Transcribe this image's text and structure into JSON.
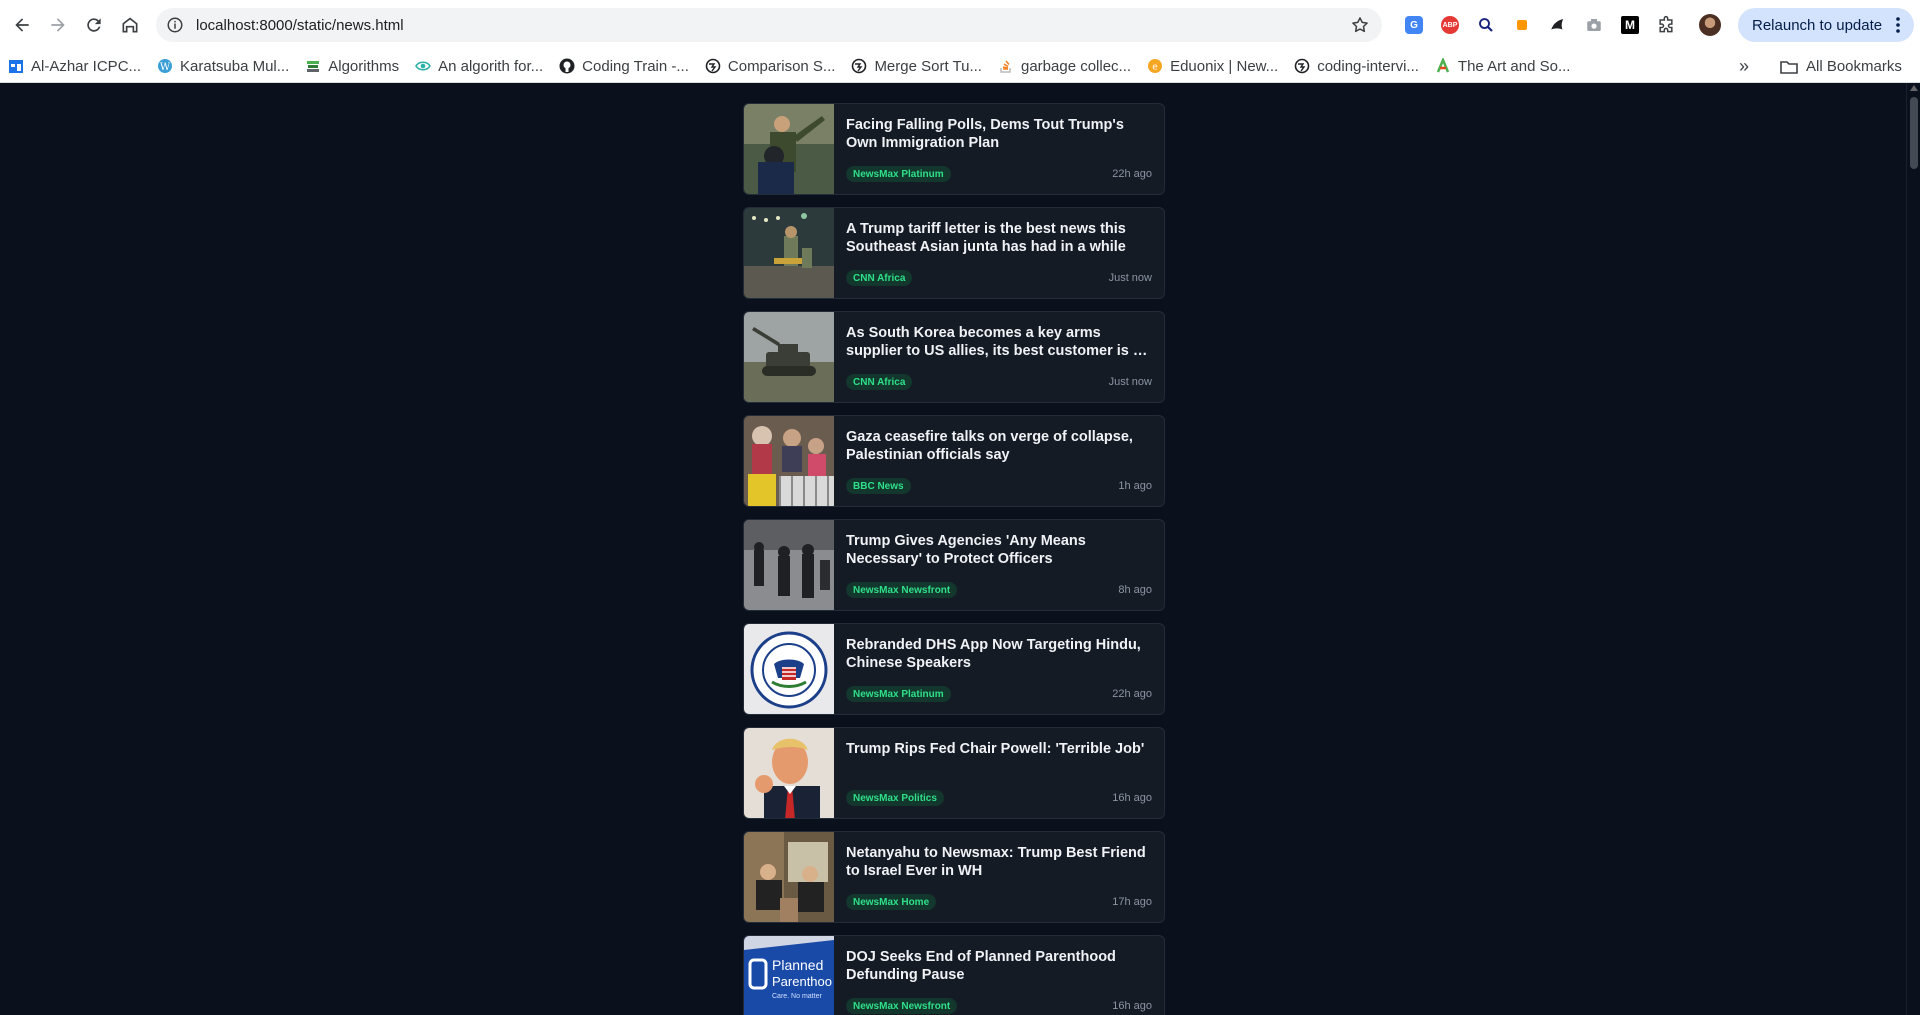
{
  "browser": {
    "url": "localhost:8000/static/news.html",
    "relaunch_label": "Relaunch to update",
    "extensions": [
      "google-translate-icon",
      "adblock-icon",
      "search-lens-icon",
      "orange-square-icon",
      "tab-manager-icon",
      "camera-icon",
      "medium-icon",
      "extensions-puzzle-icon",
      "profile-avatar"
    ],
    "bookmarks": [
      {
        "label": "Al-Azhar ICPC...",
        "icon": "calendar-icon",
        "color": "#1a73e8"
      },
      {
        "label": "Karatsuba Mul...",
        "icon": "wordpress-icon",
        "color": "#3a9fd8"
      },
      {
        "label": "Algorithms",
        "icon": "bookstack-icon",
        "color": "#5f6368"
      },
      {
        "label": "An algorith for...",
        "icon": "eye-icon",
        "color": "#2bb0a6"
      },
      {
        "label": "Coding Train -...",
        "icon": "github-icon",
        "color": "#202124"
      },
      {
        "label": "Comparison S...",
        "icon": "globe-icon",
        "color": "#202124"
      },
      {
        "label": "Merge Sort Tu...",
        "icon": "globe-icon",
        "color": "#202124"
      },
      {
        "label": "garbage collec...",
        "icon": "stackoverflow-icon",
        "color": "#f48024"
      },
      {
        "label": "Eduonix | New...",
        "icon": "eduonix-icon",
        "color": "#f5a623"
      },
      {
        "label": "coding-intervi...",
        "icon": "globe-icon",
        "color": "#202124"
      },
      {
        "label": "The Art and So...",
        "icon": "colorful-icon",
        "color": "#e64a19"
      }
    ],
    "all_bookmarks_label": "All Bookmarks"
  },
  "news": [
    {
      "headline": "Facing Falling Polls, Dems Tout Trump's Own Immigration Plan",
      "source": "NewsMax Platinum",
      "time": "22h ago"
    },
    {
      "headline": "A Trump tariff letter is the best news this Southeast Asian junta has had in a while",
      "source": "CNN Africa",
      "time": "Just now"
    },
    {
      "headline": "As South Korea becomes a key arms supplier to US allies, its best customer is on the edge of a cliff",
      "source": "CNN Africa",
      "time": "Just now"
    },
    {
      "headline": "Gaza ceasefire talks on verge of collapse, Palestinian officials say",
      "source": "BBC News",
      "time": "1h ago"
    },
    {
      "headline": "Trump Gives Agencies 'Any Means Necessary' to Protect Officers",
      "source": "NewsMax Newsfront",
      "time": "8h ago"
    },
    {
      "headline": "Rebranded DHS App Now Targeting Hindu, Chinese Speakers",
      "source": "NewsMax Platinum",
      "time": "22h ago"
    },
    {
      "headline": "Trump Rips Fed Chair Powell: 'Terrible Job'",
      "source": "NewsMax Politics",
      "time": "16h ago"
    },
    {
      "headline": "Netanyahu to Newsmax: Trump Best Friend to Israel Ever in WH",
      "source": "NewsMax Home",
      "time": "17h ago"
    },
    {
      "headline": "DOJ Seeks End of Planned Parenthood Defunding Pause",
      "source": "NewsMax Newsfront",
      "time": "16h ago"
    }
  ],
  "thumbnail_overlay_text": {
    "dhs_seal": "U.S. DEPARTMENT OF HOMELAND SECURITY",
    "planned_parenthood": "Planned Parenthood Care. No matter what."
  }
}
